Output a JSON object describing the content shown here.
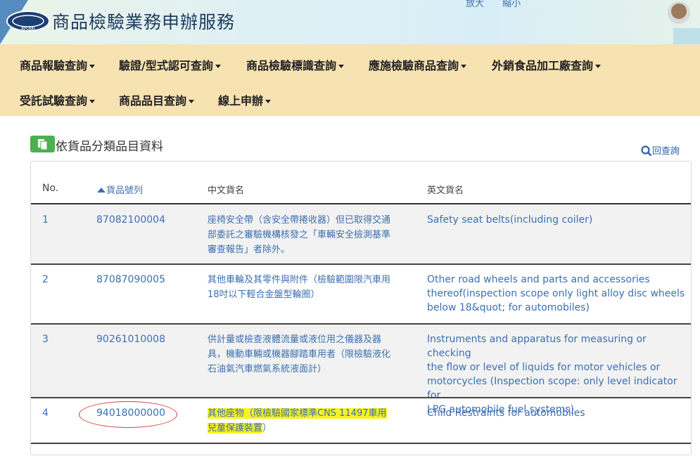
{
  "header": {
    "site_title": "商品檢驗業務申辦服務",
    "logo_text": "BSMI",
    "zoom_in": "放大",
    "zoom_out": "縮小"
  },
  "nav": {
    "items": [
      {
        "label": "商品報驗查詢"
      },
      {
        "label": "驗證/型式認可查詢"
      },
      {
        "label": "商品檢驗標識查詢"
      },
      {
        "label": "應施檢驗商品查詢"
      },
      {
        "label": "外銷食品加工廠查詢"
      },
      {
        "label": "受託試驗查詢"
      },
      {
        "label": "商品品目查詢"
      },
      {
        "label": "線上申辦"
      }
    ]
  },
  "section": {
    "title": "依貨品分類品目資料",
    "back_label": "回查詢",
    "icon": "document-icon"
  },
  "table": {
    "columns": [
      "No.",
      "貨品號列",
      "中文貨名",
      "英文貨名"
    ],
    "sorted_column": "貨品號列",
    "rows": [
      {
        "no": "1",
        "code": "87082100004",
        "zh_lines": [
          "座椅安全帶（含安全帶捲收器）但已取得交通",
          "部委託之審驗機構核發之「車輛安全檢測基準",
          "審查報告」者除外。"
        ],
        "en_lines": [
          "Safety seat belts(including coiler)"
        ]
      },
      {
        "no": "2",
        "code": "87087090005",
        "zh_lines": [
          "其他車輪及其零件與附件（檢驗範圍限汽車用",
          "18吋以下輕合金盤型輪圈）"
        ],
        "en_lines": [
          "Other road wheels and parts and accessories",
          "thereof(inspection scope only light alloy disc wheels",
          "below 18&quot; for automobiles)"
        ]
      },
      {
        "no": "3",
        "code": "90261010008",
        "zh_lines": [
          "供計量或檢查液體流量或液位用之儀器及器",
          "具，機動車輛或機器腳踏車用者（限檢驗液化",
          "石油氣汽車燃氣系統液面計）"
        ],
        "en_lines": [
          "Instruments and apparatus for measuring or checking",
          "the flow or level of liquids for motor vehicles or",
          "motorcycles (Inspection scope: only level indicator for",
          "LPG automobile fuel systems)"
        ]
      },
      {
        "no": "4",
        "code": "94018000000",
        "zh_lines": [
          "其他座物（限檢驗國家標準CNS 11497車用",
          "兒童保護裝置"
        ],
        "zh_trailing": "）",
        "en_lines": [
          "Child Restraints for automobiles"
        ]
      }
    ]
  },
  "colors": {
    "nav_bg": "#f7e2b2",
    "link_blue": "#3c6fb0",
    "highlight": "#f7f220",
    "annotation_red": "#d53c3c"
  }
}
